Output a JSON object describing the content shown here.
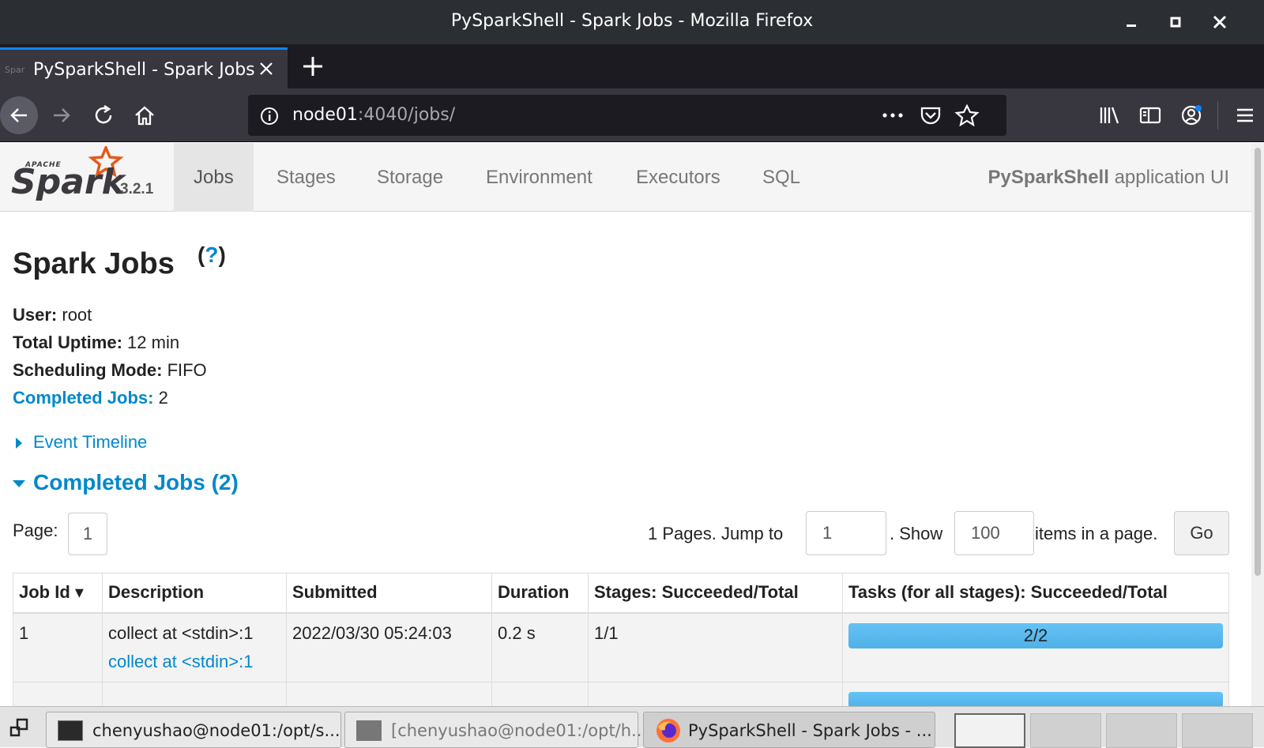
{
  "window": {
    "title": "PySparkShell - Spark Jobs - Mozilla Firefox"
  },
  "browser": {
    "tab_title": "PySparkShell - Spark Jobs",
    "url_host": "node01",
    "url_rest": ":4040/jobs/"
  },
  "spark": {
    "brand_top": "APACHE",
    "brand": "Spark",
    "version": "3.2.1",
    "nav": [
      "Jobs",
      "Stages",
      "Storage",
      "Environment",
      "Executors",
      "SQL"
    ],
    "app_name": "PySparkShell",
    "app_suffix": " application UI"
  },
  "page": {
    "title": "Spark Jobs",
    "help_open": "(",
    "help_q": "?",
    "help_close": ")",
    "user_label": "User:",
    "user_value": " root",
    "uptime_label": "Total Uptime:",
    "uptime_value": " 12 min",
    "sched_label": "Scheduling Mode:",
    "sched_value": " FIFO",
    "completed_label": "Completed Jobs:",
    "completed_value": " 2",
    "event_timeline": "Event Timeline",
    "completed_heading": "Completed Jobs (2)"
  },
  "pagination": {
    "page_label": "Page:",
    "page_current": "1",
    "pages_text": "1 Pages. Jump to",
    "jump_value": "1",
    "show_text": ". Show",
    "show_value": "100",
    "items_text": "items in a page.",
    "go_label": "Go"
  },
  "table": {
    "headers": [
      "Job Id ▾",
      "Description",
      "Submitted",
      "Duration",
      "Stages: Succeeded/Total",
      "Tasks (for all stages): Succeeded/Total"
    ],
    "rows": [
      {
        "id": "1",
        "desc": "collect at <stdin>:1",
        "desc_link": "collect at <stdin>:1",
        "submitted": "2022/03/30 05:24:03",
        "duration": "0.2 s",
        "stages": "1/1",
        "tasks": "2/2",
        "tasks_fraction": 1.0
      }
    ]
  },
  "taskbar": {
    "items": [
      "chenyushao@node01:/opt/s...",
      "[chenyushao@node01:/opt/h...",
      "PySparkShell - Spark Jobs - ..."
    ]
  },
  "colors": {
    "link": "#0088cc",
    "progress": "#5bc0f5",
    "firefox_accent": "#0a84ff"
  }
}
